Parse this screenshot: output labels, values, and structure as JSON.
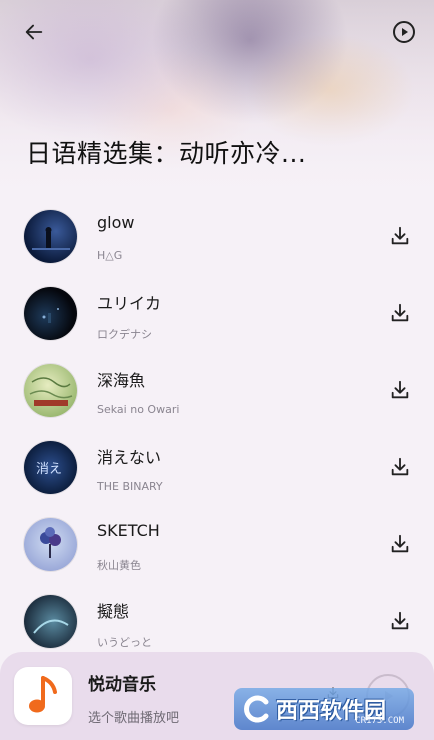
{
  "header": {
    "back_icon": "arrow-left-icon",
    "play_all_icon": "play-circle-icon",
    "title": "日语精选集：动听亦冷..."
  },
  "songs": [
    {
      "title": "glow",
      "artist": "H△G",
      "cover_colors": [
        "#0b1a3a",
        "#3a5a9a"
      ]
    },
    {
      "title": "ユリイカ",
      "artist": "ロクデナシ",
      "cover_colors": [
        "#05070d",
        "#1e3a5a"
      ]
    },
    {
      "title": "深海魚",
      "artist": "Sekai no Owari",
      "cover_colors": [
        "#c9d98f",
        "#7aa060"
      ]
    },
    {
      "title": "消えない",
      "artist": "THE BINARY",
      "cover_colors": [
        "#0d1f3f",
        "#2d4f8f"
      ]
    },
    {
      "title": "SKETCH",
      "artist": "秋山黄色",
      "cover_colors": [
        "#b8c6e8",
        "#3a4a8a"
      ]
    },
    {
      "title": "擬態",
      "artist": "いうどっと",
      "cover_colors": [
        "#1a2a3a",
        "#5a8aa0"
      ]
    }
  ],
  "player": {
    "app_name": "悦动音乐",
    "subtitle": "选个歌曲播放吧",
    "logo_icon": "music-note-icon",
    "accent": "#f06a1c"
  },
  "watermark": {
    "text": "西西软件园",
    "url_text": "CR173.COM"
  }
}
